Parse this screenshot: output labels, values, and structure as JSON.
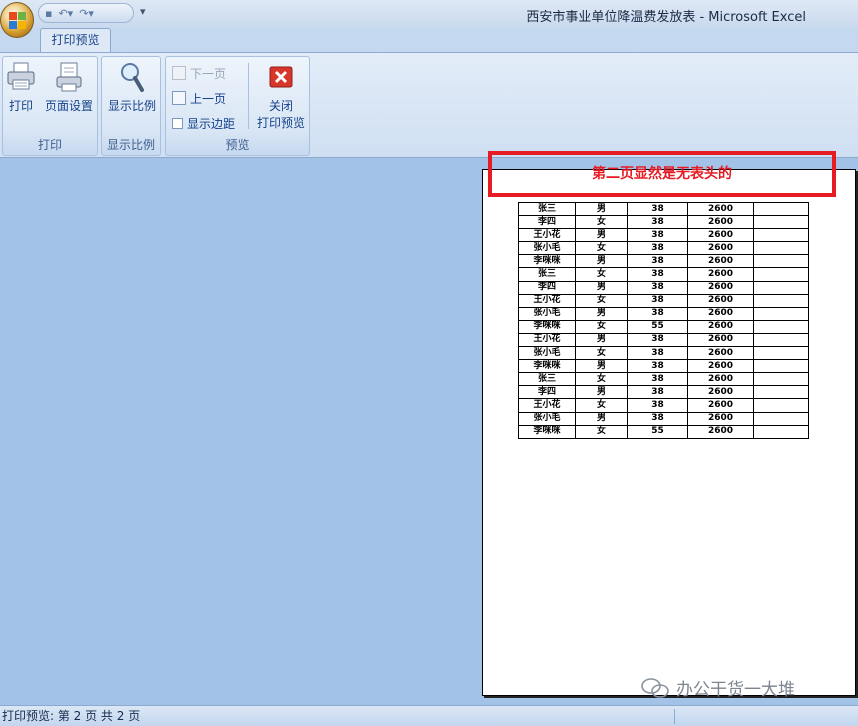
{
  "window": {
    "title": "西安市事业单位降温费发放表 - Microsoft Excel",
    "qat_more": "▾"
  },
  "tabs": {
    "active": "打印预览"
  },
  "ribbon": {
    "print_group": {
      "label": "打印",
      "print": "打印",
      "page_setup": "页面设置"
    },
    "zoom_group": {
      "label": "显示比例",
      "zoom": "显示比例"
    },
    "preview_group": {
      "label": "预览",
      "next_page": "下一页",
      "prev_page": "上一页",
      "show_margins": "显示边距",
      "close_line1": "关闭",
      "close_line2": "打印预览"
    }
  },
  "annotation": {
    "text": "第二页显然是无表头的",
    "color": "#e61b23"
  },
  "sheet": {
    "rows": [
      [
        "张三",
        "男",
        "38",
        "2600",
        ""
      ],
      [
        "李四",
        "女",
        "38",
        "2600",
        ""
      ],
      [
        "王小花",
        "男",
        "38",
        "2600",
        ""
      ],
      [
        "张小毛",
        "女",
        "38",
        "2600",
        ""
      ],
      [
        "李咪咪",
        "男",
        "38",
        "2600",
        ""
      ],
      [
        "张三",
        "女",
        "38",
        "2600",
        ""
      ],
      [
        "李四",
        "男",
        "38",
        "2600",
        ""
      ],
      [
        "王小花",
        "女",
        "38",
        "2600",
        ""
      ],
      [
        "张小毛",
        "男",
        "38",
        "2600",
        ""
      ],
      [
        "李咪咪",
        "女",
        "55",
        "2600",
        ""
      ],
      [
        "王小花",
        "男",
        "38",
        "2600",
        ""
      ],
      [
        "张小毛",
        "女",
        "38",
        "2600",
        ""
      ],
      [
        "李咪咪",
        "男",
        "38",
        "2600",
        ""
      ],
      [
        "张三",
        "女",
        "38",
        "2600",
        ""
      ],
      [
        "李四",
        "男",
        "38",
        "2600",
        ""
      ],
      [
        "王小花",
        "女",
        "38",
        "2600",
        ""
      ],
      [
        "张小毛",
        "男",
        "38",
        "2600",
        ""
      ],
      [
        "李咪咪",
        "女",
        "55",
        "2600",
        ""
      ]
    ]
  },
  "watermark": {
    "text": "办公干货一大堆"
  },
  "status": {
    "text": "打印预览: 第 2 页  共 2 页"
  }
}
